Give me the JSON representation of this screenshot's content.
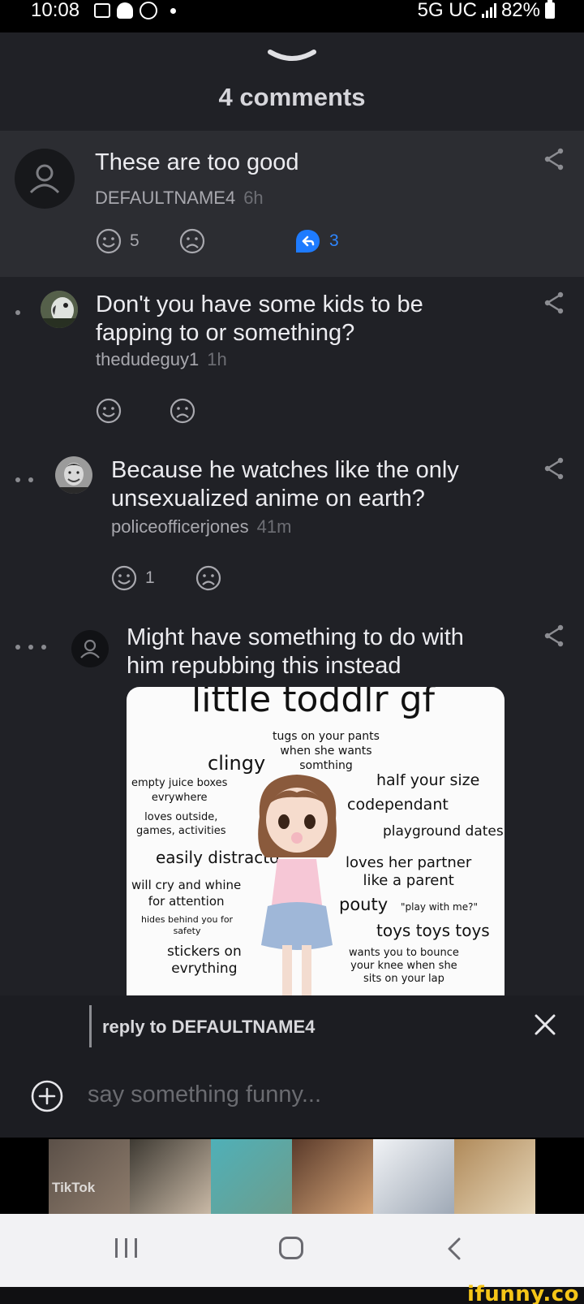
{
  "status_bar": {
    "time": "10:08",
    "network": "5G UC",
    "battery": "82%",
    "notification_icons": [
      "gallery-icon",
      "snapchat-icon",
      "smiley-icon",
      "dot-icon"
    ]
  },
  "sheet": {
    "title": "4 comments"
  },
  "comments": [
    {
      "text": "These are too good",
      "author": "DEFAULTNAME4",
      "ago": "6h",
      "smile_count": "5",
      "frown_count": "",
      "reply_count": "3",
      "depth": 0,
      "highlighted": true
    },
    {
      "text": "Don't you have some kids to be fapping to or something?",
      "author": "thedudeguy1",
      "ago": "1h",
      "smile_count": "",
      "frown_count": "",
      "depth": 1
    },
    {
      "text": "Because he watches like the only unsexualized anime on earth?",
      "author": "policeofficerjones",
      "ago": "41m",
      "smile_count": "1",
      "frown_count": "",
      "depth": 2
    },
    {
      "text": "Might have something to do with him repubbing this instead",
      "author": "",
      "ago": "",
      "depth": 3
    }
  ],
  "meme": {
    "title": "little toddlr gf",
    "labels": {
      "tugs": "tugs on your pants\nwhen she wants\nsomthing",
      "clingy": "clingy",
      "juice": "empty juice boxes\nevrywhere",
      "outside": "loves outside,\ngames, activities",
      "distracted": "easily distractd",
      "cry": "will cry and whine\nfor attention",
      "hides": "hides behind you for\nsafety",
      "stickers": "stickers on\nevrything",
      "half": "half your size",
      "codep": "codependant",
      "playground": "playground dates",
      "partner": "loves her partner\nlike a parent",
      "pouty": "pouty",
      "play": "\"play with me?\"",
      "toys": "toys toys toys",
      "bounce": "wants you to bounce\nyour knee when she\nsits on your lap"
    }
  },
  "reply_bar": {
    "reply_to": "reply to DEFAULTNAME4",
    "placeholder": "say something funny..."
  },
  "ad": {
    "brand": "TikTok"
  },
  "watermark": "ifunny.co",
  "colors": {
    "background": "#202126",
    "highlight": "#2c2d32",
    "accent_blue": "#1e7bff",
    "muted": "#a8a8ae"
  }
}
